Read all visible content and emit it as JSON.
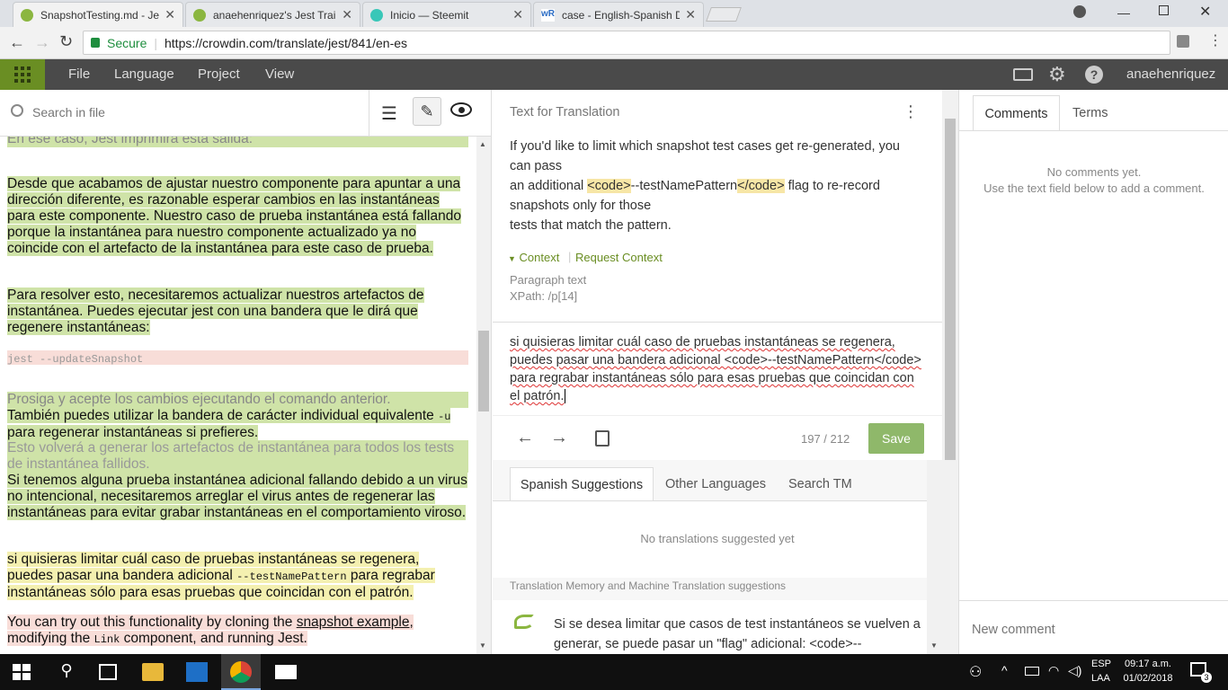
{
  "browser": {
    "tabs": [
      {
        "title": "SnapshotTesting.md - Jes",
        "active": true
      },
      {
        "title": "anaehenriquez's Jest Trai",
        "active": false
      },
      {
        "title": "Inicio — Steemit",
        "active": false
      },
      {
        "title": "case - English-Spanish D",
        "active": false
      }
    ],
    "secure_label": "Secure",
    "url": "https://crowdin.com/translate/jest/841/en-es"
  },
  "app": {
    "menu": [
      "File",
      "Language",
      "Project",
      "View"
    ],
    "username": "anaehenriquez"
  },
  "left": {
    "search_placeholder": "Search in file",
    "p0": "En ese caso, Jest imprimirá esta salida:",
    "p1": "Desde que acabamos de ajustar nuestro componente para apuntar a una dirección diferente, es razonable esperar cambios en las instantáneas para este componente. Nuestro caso de prueba instantánea está fallando porque la instantánea para nuestro componente actualizado ya no coincide con el artefacto de la instantánea para este caso de prueba.",
    "p2": "Para resolver esto, necesitaremos actualizar nuestros artefactos de instantánea. Puedes ejecutar jest con una bandera que le dirá que regenere instantáneas:",
    "code1": "jest --updateSnapshot",
    "p3a": "Prosiga y acepte los cambios ejecutando el comando anterior.",
    "p3b_pre": "También puedes utilizar la bandera de carácter individual equivalente ",
    "p3b_code": "-u",
    "p3b_post": " para regenerar instantáneas si prefieres.",
    "p4": "Esto volverá a generar los artefactos de instantánea para todos los tests de instantánea fallidos.",
    "p5": "Si tenemos alguna prueba instantánea adicional fallando debido a un virus no intencional, necesitaremos arreglar el virus antes de regenerar las instantáneas para evitar grabar instantáneas en el comportamiento viroso.",
    "p6_pre": "si quisieras limitar cuál caso de pruebas instantáneas se regenera, puedes pasar una bandera adicional ",
    "p6_code": "--testNamePattern",
    "p6_post": " para regrabar instantáneas sólo para esas pruebas que coincidan con el patrón.",
    "p7_pre": "You can try out this functionality by cloning the ",
    "p7_link": "snapshot example",
    "p7_mid": ", modifying the ",
    "p7_code": "Link",
    "p7_post": " component, and running Jest."
  },
  "middle": {
    "header": "Text for Translation",
    "source_1": "If you'd like to limit which snapshot test cases get re-generated, you can pass",
    "source_2_pre": "an additional ",
    "source_2_tag1": "<code>",
    "source_2_mid": "--testNamePattern",
    "source_2_tag2": "</code>",
    "source_2_post": " flag to re-record snapshots only for those",
    "source_3": "tests that match the pattern.",
    "context_label": "Context",
    "request_context": "Request Context",
    "paragraph_text": "Paragraph text",
    "xpath": "XPath: /p[14]",
    "translation": "si quisieras limitar cuál caso de pruebas instantáneas se regenera, puedes pasar una bandera adicional <code>--testNamePattern</code> para regrabar instantáneas sólo para esas pruebas que coincidan con el patrón.",
    "counter": "197 / 212",
    "save": "Save",
    "tabs": [
      "Spanish Suggestions",
      "Other Languages",
      "Search TM"
    ],
    "no_suggestions": "No translations suggested yet",
    "tm_header": "Translation Memory and Machine Translation suggestions",
    "tm_suggestion": "Si se desea limitar que casos de test instantáneos se vuelven a generar, se puede pasar un \"flag\" adicional: <code>--"
  },
  "right": {
    "tabs": [
      "Comments",
      "Terms"
    ],
    "no_comments": "No comments yet.",
    "hint": "Use the text field below to add a comment.",
    "new_comment_placeholder": "New comment"
  },
  "taskbar": {
    "lang1": "ESP",
    "lang2": "LAA",
    "time": "09:17 a.m.",
    "date": "01/02/2018",
    "notif_count": "3"
  },
  "colors": {
    "accent_green": "#6a8e23",
    "save_green": "#8fb86a",
    "header_dark": "#4a4a4a"
  }
}
